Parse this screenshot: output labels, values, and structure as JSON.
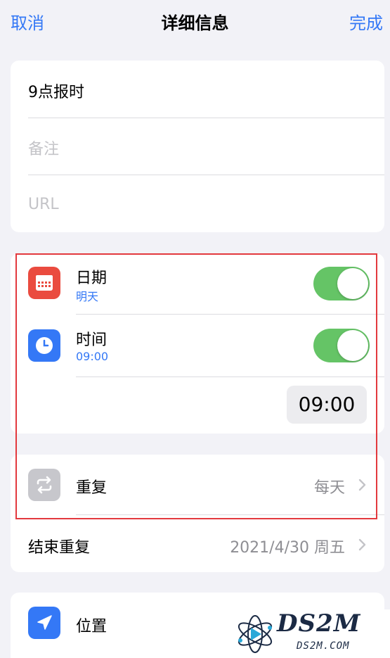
{
  "nav": {
    "cancel_label": "取消",
    "title": "详细信息",
    "done_label": "完成"
  },
  "info": {
    "title_value": "9点报时",
    "notes_placeholder": "备注",
    "url_placeholder": "URL"
  },
  "date_row": {
    "title": "日期",
    "subtitle": "明天",
    "toggle_on": true
  },
  "time_row": {
    "title": "时间",
    "subtitle": "09:00",
    "toggle_on": true,
    "picker_value": "09:00"
  },
  "repeat_row": {
    "title": "重复",
    "value": "每天"
  },
  "end_repeat_row": {
    "title": "结束重复",
    "value": "2021/4/30 周五"
  },
  "location_row": {
    "title": "位置"
  },
  "watermark": {
    "brand": "DS2M",
    "domain": "DS2M.COM"
  },
  "colors": {
    "accent": "#3478f6",
    "toggle_on": "#65c466",
    "date_icon": "#ea4b3f",
    "time_icon": "#3478f6",
    "highlight": "#e3393e"
  }
}
